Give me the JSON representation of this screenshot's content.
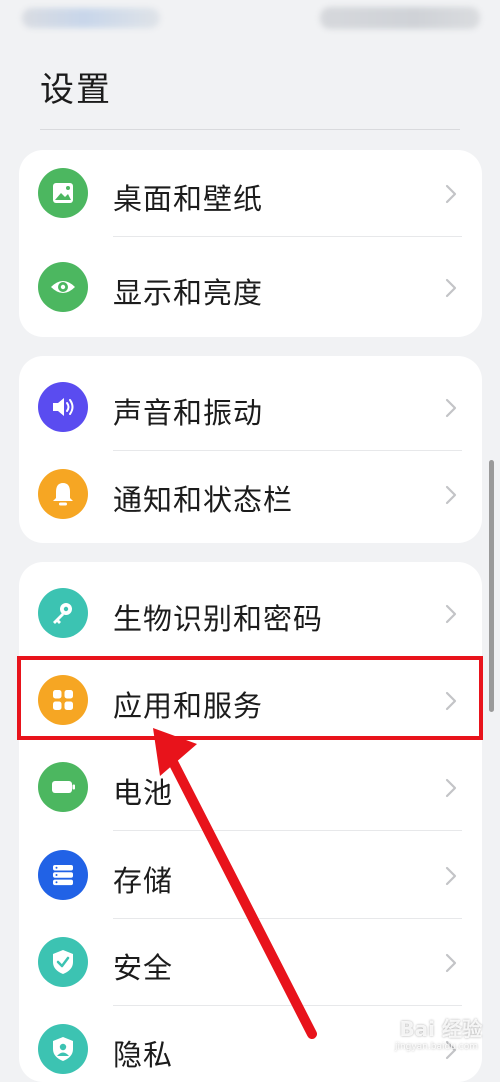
{
  "page": {
    "title": "设置"
  },
  "groups": [
    {
      "items": [
        {
          "label": "桌面和壁纸",
          "icon": "wallpaper-icon",
          "color": "#4cb760"
        },
        {
          "label": "显示和亮度",
          "icon": "eye-icon",
          "color": "#4cb760"
        }
      ]
    },
    {
      "items": [
        {
          "label": "声音和振动",
          "icon": "speaker-icon",
          "color": "#5a4cf0"
        },
        {
          "label": "通知和状态栏",
          "icon": "bell-icon",
          "color": "#f6a623"
        }
      ]
    },
    {
      "items": [
        {
          "label": "生物识别和密码",
          "icon": "key-icon",
          "color": "#3cc3b2"
        },
        {
          "label": "应用和服务",
          "icon": "apps-grid-icon",
          "color": "#f6a623"
        },
        {
          "label": "电池",
          "icon": "battery-icon",
          "color": "#4cb760"
        },
        {
          "label": "存储",
          "icon": "storage-icon",
          "color": "#2162e6"
        },
        {
          "label": "安全",
          "icon": "shield-check-icon",
          "color": "#3cc3b2"
        },
        {
          "label": "隐私",
          "icon": "privacy-icon",
          "color": "#3cc3b2"
        }
      ]
    }
  ],
  "annotation": {
    "highlight_target": "应用和服务",
    "highlight_color": "#e8131b"
  },
  "watermark": {
    "text": "Bai 经验",
    "subtext": "jingyan.baidu.com"
  }
}
